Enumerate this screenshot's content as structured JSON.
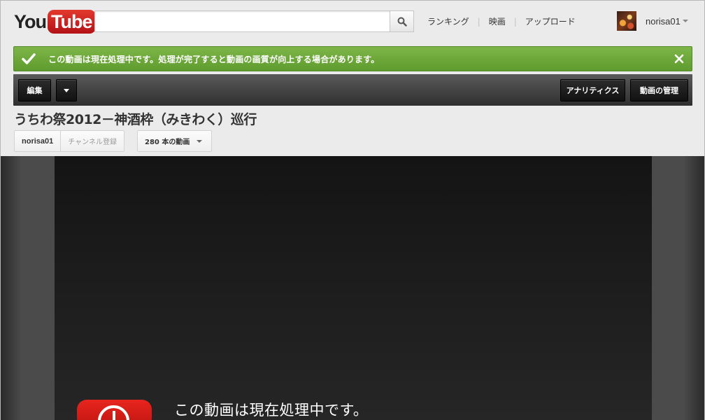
{
  "masthead": {
    "logo": {
      "you": "You",
      "tube": "Tube"
    },
    "search": {
      "value": "",
      "placeholder": ""
    },
    "nav": [
      {
        "label": "ランキング"
      },
      {
        "label": "映画"
      },
      {
        "label": "アップロード"
      }
    ],
    "user": {
      "name": "norisa01"
    }
  },
  "banner": {
    "message": "この動画は現在処理中です。処理が完了すると動画の画質が向上する場合があります。",
    "color": "#6aa53a"
  },
  "toolbar": {
    "edit_label": "編集",
    "analytics_label": "アナリティクス",
    "manage_label": "動画の管理"
  },
  "video": {
    "title": "うちわ祭2012－神酒枠（みきわく）巡行",
    "channel": "norisa01",
    "subscribe_label": "チャンネル登録",
    "video_count_label": "280 本の動画"
  },
  "player": {
    "processing_message": "この動画は現在処理中です。"
  }
}
